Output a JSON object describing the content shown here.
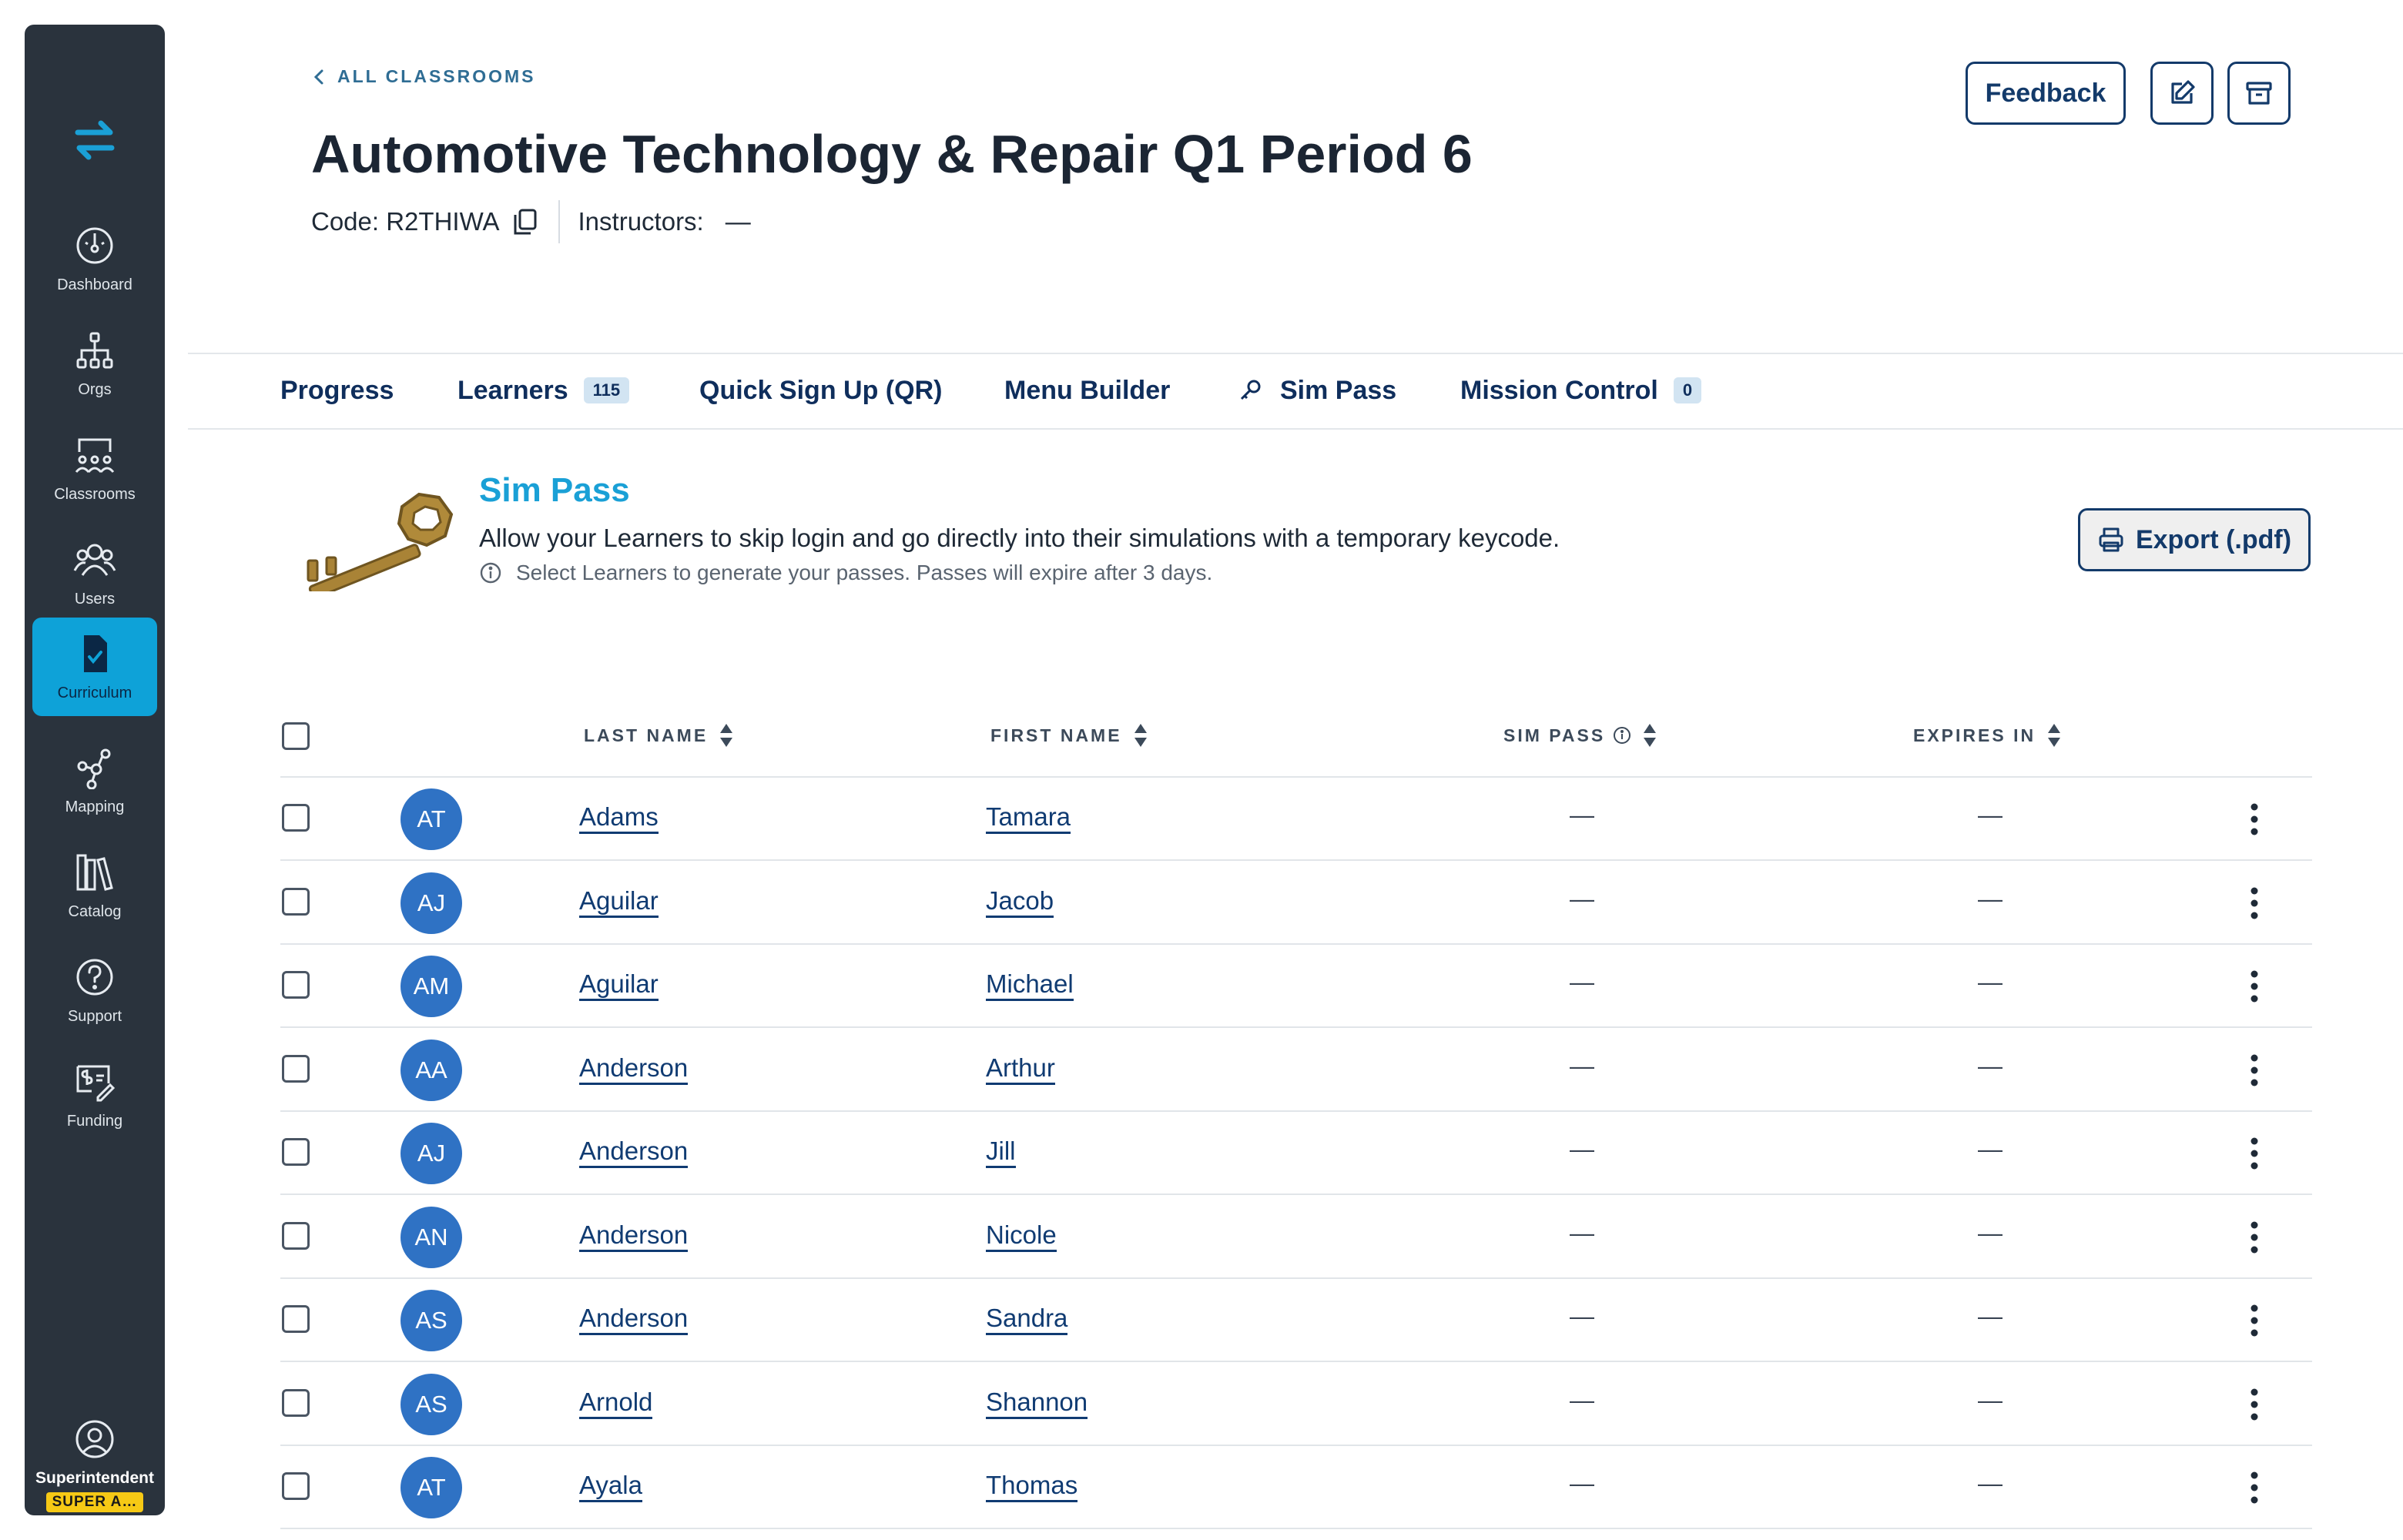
{
  "sidebar": {
    "items": [
      {
        "label": "Dashboard",
        "icon": "dashboard-icon",
        "active": false
      },
      {
        "label": "Orgs",
        "icon": "org-chart-icon",
        "active": false
      },
      {
        "label": "Classrooms",
        "icon": "classroom-icon",
        "active": false
      },
      {
        "label": "Users",
        "icon": "users-icon",
        "active": false
      },
      {
        "label": "Curriculum",
        "icon": "curriculum-icon",
        "active": true
      },
      {
        "label": "Mapping",
        "icon": "mapping-icon",
        "active": false
      },
      {
        "label": "Catalog",
        "icon": "catalog-icon",
        "active": false
      },
      {
        "label": "Support",
        "icon": "help-icon",
        "active": false
      },
      {
        "label": "Funding",
        "icon": "funding-icon",
        "active": false
      }
    ],
    "user": {
      "name": "Superintendent",
      "badge": "SUPER A…"
    },
    "accent": "#0ea2d8",
    "background": "#2a333d"
  },
  "header": {
    "back_label": "ALL CLASSROOMS",
    "title": "Automotive Technology & Repair Q1 Period 6",
    "code": "Code: R2THIWA",
    "instructors_label": "Instructors:",
    "instructors_value": "—",
    "feedback_label": "Feedback"
  },
  "tabs": [
    {
      "label": "Progress"
    },
    {
      "label": "Learners",
      "count": "115"
    },
    {
      "label": "Quick Sign Up (QR)"
    },
    {
      "label": "Menu Builder"
    },
    {
      "label": "Sim Pass",
      "icon": "key-icon"
    },
    {
      "label": "Mission Control",
      "count": "0"
    }
  ],
  "sim_pass": {
    "title": "Sim Pass",
    "description": "Allow your Learners to skip login and go directly into their simulations with a temporary keycode.",
    "note": "Select Learners to generate your passes. Passes will expire after 3 days.",
    "export_label": "Export (.pdf)"
  },
  "table": {
    "columns": {
      "last_name": "LAST NAME",
      "first_name": "FIRST NAME",
      "sim_pass": "SIM PASS",
      "expires_in": "EXPIRES IN"
    },
    "rows": [
      {
        "initials": "AT",
        "last": "Adams",
        "first": "Tamara",
        "sim_pass": "—",
        "expires": "—"
      },
      {
        "initials": "AJ",
        "last": "Aguilar",
        "first": "Jacob",
        "sim_pass": "—",
        "expires": "—"
      },
      {
        "initials": "AM",
        "last": "Aguilar",
        "first": "Michael",
        "sim_pass": "—",
        "expires": "—"
      },
      {
        "initials": "AA",
        "last": "Anderson",
        "first": "Arthur",
        "sim_pass": "—",
        "expires": "—"
      },
      {
        "initials": "AJ",
        "last": "Anderson",
        "first": "Jill",
        "sim_pass": "—",
        "expires": "—"
      },
      {
        "initials": "AN",
        "last": "Anderson",
        "first": "Nicole",
        "sim_pass": "—",
        "expires": "—"
      },
      {
        "initials": "AS",
        "last": "Anderson",
        "first": "Sandra",
        "sim_pass": "—",
        "expires": "—"
      },
      {
        "initials": "AS",
        "last": "Arnold",
        "first": "Shannon",
        "sim_pass": "—",
        "expires": "—"
      },
      {
        "initials": "AT",
        "last": "Ayala",
        "first": "Thomas",
        "sim_pass": "—",
        "expires": "—"
      }
    ]
  }
}
